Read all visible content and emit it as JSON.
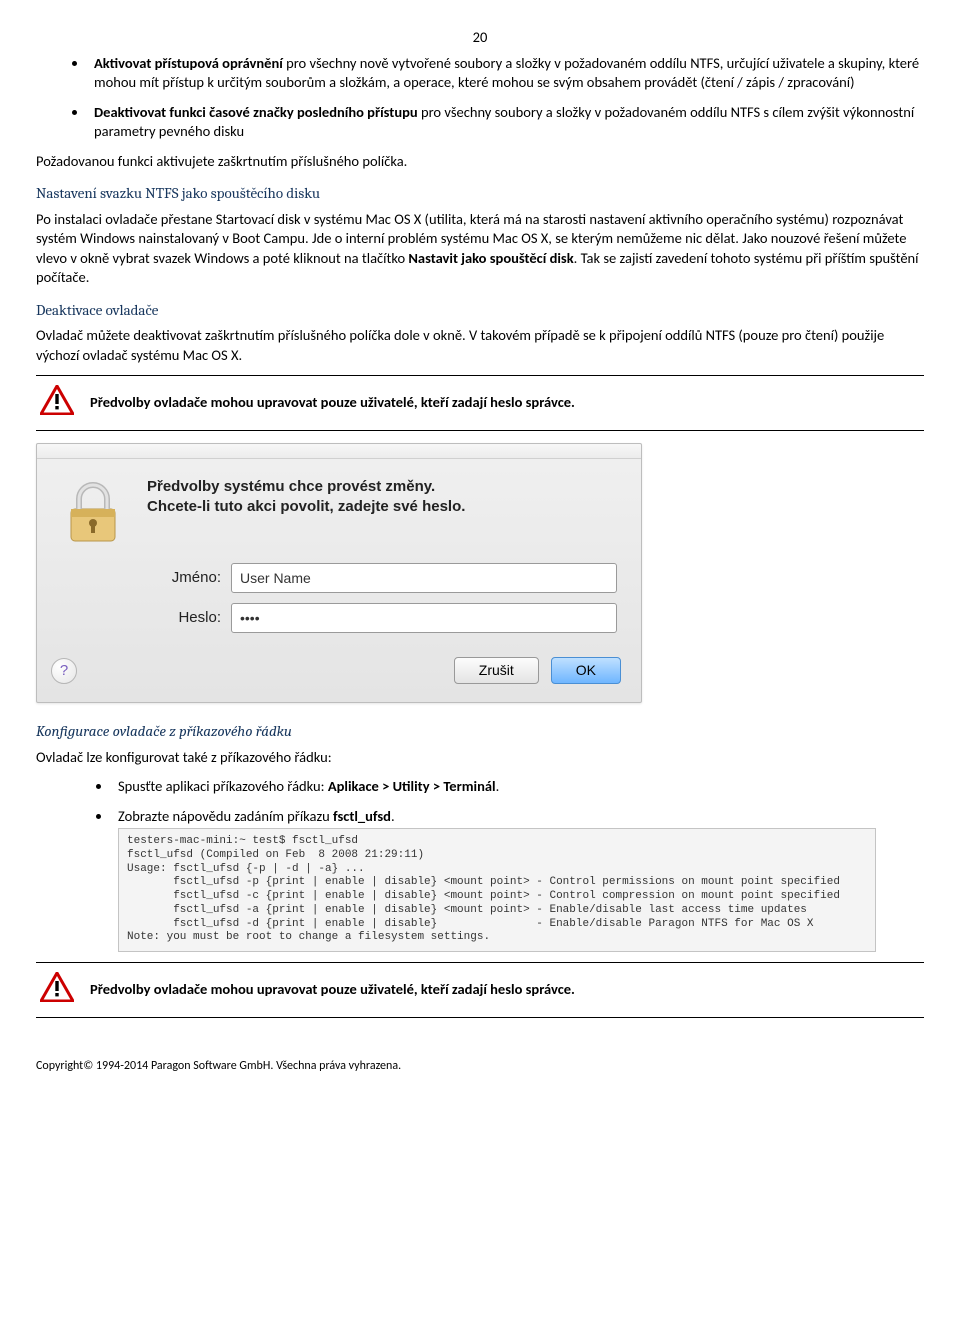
{
  "page_number": "20",
  "bullets_top": [
    {
      "prefix_bold": "Aktivovat přístupová oprávnění",
      "rest": " pro všechny nově vytvořené soubory a složky v požadovaném oddílu NTFS, určující uživatele a skupiny, které mohou mít přístup k určitým souborům a složkám, a operace, které mohou se svým obsahem provádět (čtení / zápis / zpracování)"
    },
    {
      "prefix_bold": "Deaktivovat funkci časové značky posledního přístupu",
      "rest": " pro všechny soubory a složky v požadovaném oddílu NTFS s cílem zvýšit výkonnostní parametry pevného disku"
    }
  ],
  "para_activate": "Požadovanou funkci aktivujete zaškrtnutím příslušného políčka.",
  "heading_boot": "Nastavení svazku NTFS jako spouštěcího disku",
  "para_boot_parts": {
    "p1": "Po instalaci ovladače přestane Startovací disk v systému Mac OS X (utilita, která má na starosti nastavení aktivního operačního systému) rozpoznávat systém Windows nainstalovaný v Boot Campu. Jde o interní problém systému Mac OS X, se kterým nemůžeme nic dělat. Jako nouzové řešení můžete vlevo v okně vybrat svazek Windows a poté kliknout na tlačítko ",
    "bold": "Nastavit jako spouštěcí disk",
    "p2": ". Tak se zajistí zavedení tohoto systému při příštím spuštění počítače."
  },
  "heading_deact": "Deaktivace ovladače",
  "para_deact": "Ovladač můžete deaktivovat zaškrtnutím příslušného políčka dole v okně. V takovém případě se k připojení oddílů NTFS (pouze pro čtení) použije výchozí ovladač systému Mac OS X.",
  "alert_text": "Předvolby ovladače mohou upravovat pouze uživatelé, kteří zadají heslo správce.",
  "dialog": {
    "line1": "Předvolby systému chce provést změny.",
    "line2": "Chcete-li tuto akci povolit, zadejte své heslo.",
    "label_name": "Jméno:",
    "value_name": "User Name",
    "label_pass": "Heslo:",
    "value_pass": "••••",
    "btn_cancel": "Zrušit",
    "btn_ok": "OK",
    "help": "?"
  },
  "heading_cli": "Konfigurace ovladače z příkazového řádku",
  "para_cli": "Ovladač lze konfigurovat také z příkazového řádku:",
  "cli_bullets": [
    {
      "pre": "Spusťte aplikaci příkazového řádku: ",
      "bold": "Aplikace > Utility > Terminál",
      "post": "."
    },
    {
      "pre": "Zobrazte nápovědu zadáním příkazu ",
      "bold": "fsctl_ufsd",
      "post": "."
    }
  ],
  "terminal": "testers-mac-mini:~ test$ fsctl_ufsd\nfsctl_ufsd (Compiled on Feb  8 2008 21:29:11)\nUsage: fsctl_ufsd {-p | -d | -a} ...\n       fsctl_ufsd -p {print | enable | disable} <mount point> - Control permissions on mount point specified\n       fsctl_ufsd -c {print | enable | disable} <mount point> - Control compression on mount point specified\n       fsctl_ufsd -a {print | enable | disable} <mount point> - Enable/disable last access time updates\n       fsctl_ufsd -d {print | enable | disable}               - Enable/disable Paragon NTFS for Mac OS X\nNote: you must be root to change a filesystem settings.",
  "footer": "Copyright© 1994-2014 Paragon Software GmbH. Všechna práva vyhrazena."
}
